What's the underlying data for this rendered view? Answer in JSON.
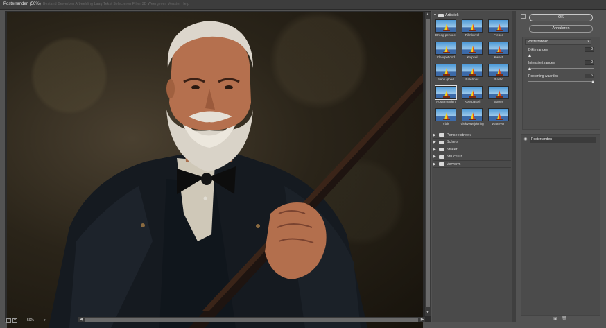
{
  "window": {
    "title": "Posterranden (50%)",
    "ghost_menu": "Bestand  Bewerken  Afbeelding  Laag  Tekst  Selecteren  Filter  3D  Weergeven  Venster  Help"
  },
  "preview": {
    "zoom_value": "50%",
    "zoom_out": "−",
    "zoom_in": "+",
    "caret": "▾",
    "scroll_left": "◀",
    "scroll_right": "▶",
    "scroll_up": "▲",
    "scroll_down": "▼"
  },
  "gallery": {
    "open_folder": {
      "arrow": "▼",
      "label": "Artistiek"
    },
    "thumbnails": [
      {
        "label": "Droog penseel"
      },
      {
        "label": "Filmkorrel"
      },
      {
        "label": "Fresco"
      },
      {
        "label": "Kleurpotlood"
      },
      {
        "label": "Knipsel"
      },
      {
        "label": "Kwast"
      },
      {
        "label": "Neon gloed"
      },
      {
        "label": "Paletmes"
      },
      {
        "label": "Plastic"
      },
      {
        "label": "Posterranden"
      },
      {
        "label": "Ruw pastel"
      },
      {
        "label": "Spons"
      },
      {
        "label": "Vlak"
      },
      {
        "label": "Vlekverwijdering"
      },
      {
        "label": "Waterverf"
      }
    ],
    "selected_index": 9,
    "other_folders": [
      {
        "arrow": "▶",
        "label": "Penseelstreek"
      },
      {
        "arrow": "▶",
        "label": "Schets"
      },
      {
        "arrow": "▶",
        "label": "Stileer"
      },
      {
        "arrow": "▶",
        "label": "Structuur"
      },
      {
        "arrow": "▶",
        "label": "Vervorm"
      }
    ]
  },
  "panel": {
    "collapse_icon": "^",
    "ok_label": "OK",
    "cancel_label": "Annuleren",
    "filter_select": "Posterranden",
    "caret": "▾",
    "params": [
      {
        "label": "Dikte randen",
        "value": "0",
        "fraction": 0.0
      },
      {
        "label": "Intensiteit randen",
        "value": "0",
        "fraction": 0.0
      },
      {
        "label": "Posterting waarden",
        "value": "6",
        "fraction": 1.0
      }
    ],
    "layer": {
      "eye": "◉",
      "name": "Posterranden"
    },
    "tools": {
      "new": "▣",
      "delete": "🗑"
    }
  },
  "colors": {
    "ui_bg": "#535353",
    "panel_bg": "#4a4a4a",
    "accent_text": "#dcdcdc"
  }
}
